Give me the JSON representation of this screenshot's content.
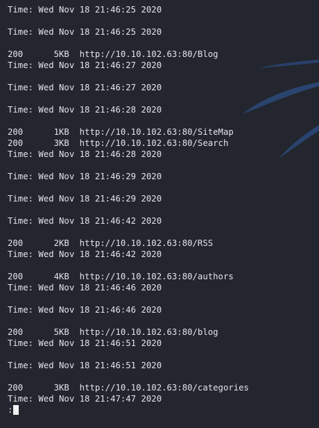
{
  "terminal": {
    "lines": [
      "Time: Wed Nov 18 21:46:25 2020",
      "",
      "Time: Wed Nov 18 21:46:25 2020",
      "",
      "200      5KB  http://10.10.102.63:80/Blog",
      "Time: Wed Nov 18 21:46:27 2020",
      "",
      "Time: Wed Nov 18 21:46:27 2020",
      "",
      "Time: Wed Nov 18 21:46:28 2020",
      "",
      "200      1KB  http://10.10.102.63:80/SiteMap",
      "200      3KB  http://10.10.102.63:80/Search",
      "Time: Wed Nov 18 21:46:28 2020",
      "",
      "Time: Wed Nov 18 21:46:29 2020",
      "",
      "Time: Wed Nov 18 21:46:29 2020",
      "",
      "Time: Wed Nov 18 21:46:42 2020",
      "",
      "200      2KB  http://10.10.102.63:80/RSS",
      "Time: Wed Nov 18 21:46:42 2020",
      "",
      "200      4KB  http://10.10.102.63:80/authors",
      "Time: Wed Nov 18 21:46:46 2020",
      "",
      "Time: Wed Nov 18 21:46:46 2020",
      "",
      "200      5KB  http://10.10.102.63:80/blog",
      "Time: Wed Nov 18 21:46:51 2020",
      "",
      "Time: Wed Nov 18 21:46:51 2020",
      "",
      "200      3KB  http://10.10.102.63:80/categories",
      "Time: Wed Nov 18 21:47:47 2020"
    ],
    "prompt": ":",
    "colors": {
      "background": "#23262e",
      "text": "#e2e4e8",
      "cursor": "#f2f2f2",
      "wallpaper_swoosh": "#2c4a7a"
    }
  }
}
